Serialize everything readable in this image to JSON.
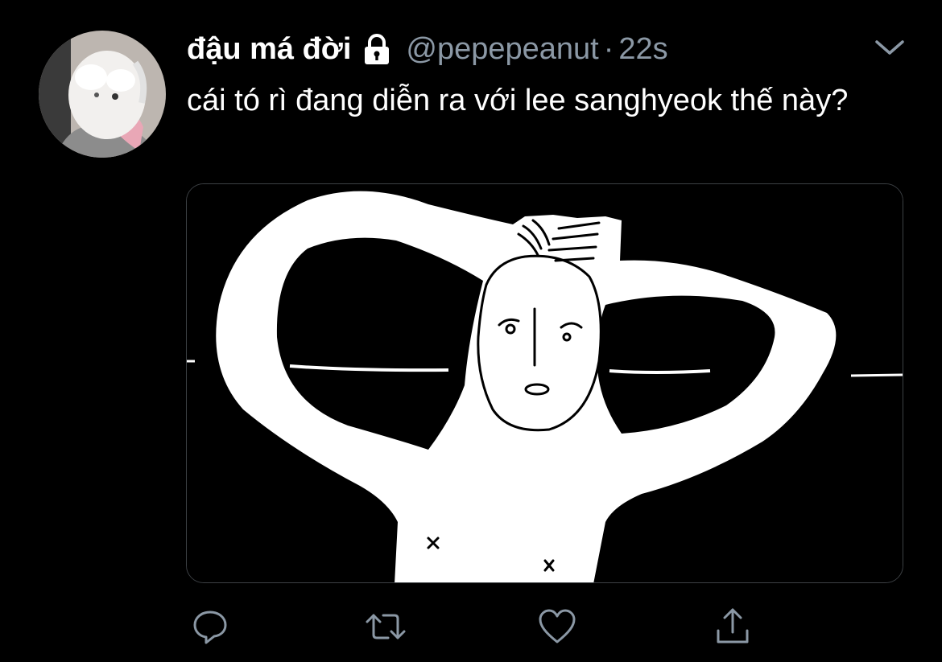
{
  "tweet": {
    "display_name": "đậu má đời",
    "handle": "@pepepeanut",
    "separator": "·",
    "timestamp": "22s",
    "text": "cái tó rì đang diễn ra với lee sanghyeok thế này?",
    "icons": {
      "lock": "lock-icon",
      "caret": "chevron-down-icon",
      "reply": "reply-icon",
      "retweet": "retweet-icon",
      "like": "heart-icon",
      "share": "share-icon"
    },
    "media": {
      "kind": "hand-drawn meme illustration"
    }
  },
  "colors": {
    "background": "#000000",
    "primary_text": "#ffffff",
    "secondary_text": "#8b98a5",
    "border": "#3d4145"
  }
}
